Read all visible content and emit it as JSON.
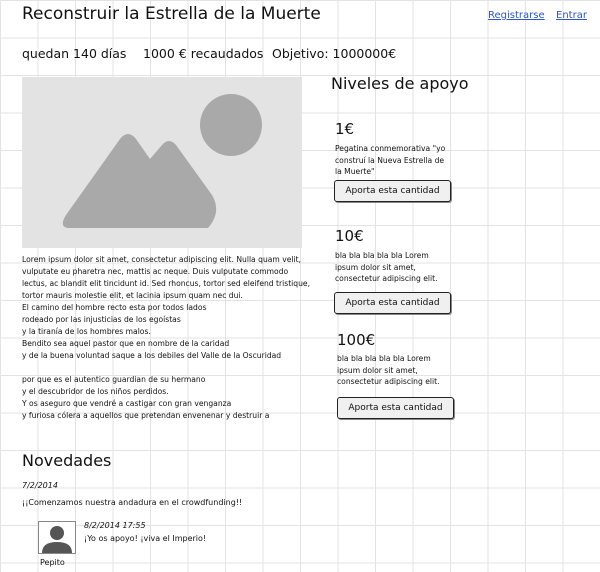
{
  "header": {
    "title": "Reconstruir la Estrella de la Muerte",
    "register_label": "Registrarse",
    "login_label": "Entrar"
  },
  "stats": {
    "days_left": "quedan 140 días",
    "raised": "1000 € recaudados",
    "goal": "Objetivo: 1000000€"
  },
  "hero_image": {
    "icon": "image-placeholder-icon"
  },
  "description": "Lorem ipsum dolor sit amet, consectetur adipiscing elit. Nulla quam velit, vulputate eu pharetra nec, mattis ac neque. Duis vulputate commodo lectus, ac blandit elit tincidunt id. Sed rhoncus, tortor sed eleifend tristique, tortor mauris molestie elit, et lacinia ipsum quam nec dui.\nEl camino del hombre recto esta por todos lados\nrodeado por las injusticias de los egoístas\ny la tiranía de los hombres malos.\nBendito sea aquel pastor que en nombre de la caridad\ny de la buena voluntad saque a los debiles del Valle de la Oscuridad\n\npor que es el autentico guardian de su hermano\ny el descubridor de los niños perdidos.\nY os aseguro que vendré a castigar con gran venganza\ny furiosa cólera a aquellos que pretendan envenenar y destruir a",
  "support": {
    "title": "Niveles de apoyo",
    "tiers": [
      {
        "amount": "1€",
        "description": "Pegatina conmemorativa \"yo\nconstruí la Nueva Estrella de\nla Muerte\"",
        "button": "Aporta esta cantidad"
      },
      {
        "amount": "10€",
        "description": "bla bla bla bla bla Lorem\nipsum dolor sit amet,\nconsectetur adipiscing elit.",
        "button": "Aporta esta cantidad"
      },
      {
        "amount": "100€",
        "description": "bla bla bla bla bla Lorem\nipsum dolor sit amet,\nconsectetur adipiscing elit.",
        "button": "Aporta esta cantidad"
      }
    ]
  },
  "news": {
    "title": "Novedades",
    "post": {
      "date": "7/2/2014",
      "text": "¡¡Comenzamos nuestra andadura en el crowdfunding!!"
    },
    "comment": {
      "author": "Pepito",
      "date": "8/2/2014 17:55",
      "text": "¡Yo os apoyo! ¡viva el Imperio!",
      "avatar_icon": "user-avatar-icon"
    }
  }
}
